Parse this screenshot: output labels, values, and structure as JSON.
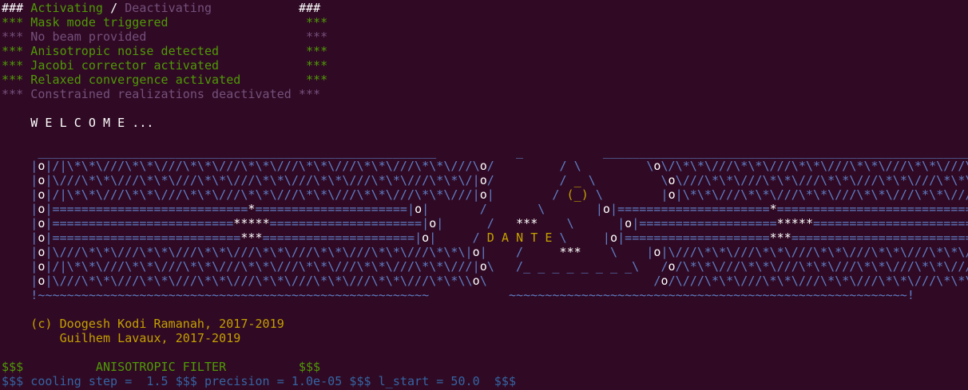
{
  "colors": {
    "background": "#300a24",
    "white": "#ffffff",
    "green": "#4e9a06",
    "purple": "#75507b",
    "blue": "#5f7fc7",
    "orange": "#c4a000",
    "dark_blue": "#3465a4"
  },
  "lines": [
    [
      {
        "t": "### ",
        "c": "w"
      },
      {
        "t": "Activating",
        "c": "g"
      },
      {
        "t": " / ",
        "c": "w"
      },
      {
        "t": "Deactivating",
        "c": "m"
      },
      {
        "t": "            ",
        "c": "w"
      },
      {
        "t": "###",
        "c": "w"
      }
    ],
    [
      {
        "t": "*** Mask mode triggered                   ***",
        "c": "g"
      }
    ],
    [
      {
        "t": "*** No beam provided                      ***",
        "c": "m"
      }
    ],
    [
      {
        "t": "*** Anisotropic noise detected            ***",
        "c": "g"
      }
    ],
    [
      {
        "t": "*** Jacobi corrector activated            ***",
        "c": "g"
      }
    ],
    [
      {
        "t": "*** Relaxed convergence activated         ***",
        "c": "g"
      }
    ],
    [
      {
        "t": "*** Constrained realizations deactivated ***",
        "c": "m"
      }
    ],
    [
      {
        "t": "",
        "c": "w"
      }
    ],
    [
      {
        "t": "    W E L C O M E ...",
        "c": "w"
      }
    ],
    [
      {
        "t": "",
        "c": "w"
      }
    ],
    [
      {
        "t": "     _______________________________________________________           _           _______________________________________________________",
        "c": "b"
      }
    ],
    [
      {
        "t": "    |",
        "c": "b"
      },
      {
        "t": "o",
        "c": "w"
      },
      {
        "t": "|/|\\*\\*\\///\\*\\*\\///\\*\\*\\///\\*\\*\\///\\*\\*\\///\\*\\*\\///\\*\\*\\///\\",
        "c": "b"
      },
      {
        "t": "o",
        "c": "w"
      },
      {
        "t": "/         / \\         \\",
        "c": "b"
      },
      {
        "t": "o",
        "c": "w"
      },
      {
        "t": "\\/\\*\\*\\///\\*\\*\\///\\*\\*\\///\\*\\*\\///\\*\\*\\///\\*\\*\\///\\*\\*\\///|",
        "c": "b"
      },
      {
        "t": "o",
        "c": "w"
      },
      {
        "t": "|",
        "c": "b"
      }
    ],
    [
      {
        "t": "    |",
        "c": "b"
      },
      {
        "t": "o",
        "c": "w"
      },
      {
        "t": "|\\///\\*\\*\\///\\*\\*\\///\\*\\*\\///\\*\\*\\///\\*\\*\\///\\*\\*\\///\\*\\*\\/|",
        "c": "b"
      },
      {
        "t": "o",
        "c": "w"
      },
      {
        "t": "/         /",
        "c": "b"
      },
      {
        "t": " _ ",
        "c": "o"
      },
      {
        "t": "\\         \\",
        "c": "b"
      },
      {
        "t": "o",
        "c": "w"
      },
      {
        "t": "\\///\\*\\*\\///\\*\\*\\///\\*\\*\\///\\*\\*\\///\\*\\*\\///\\*\\*\\///\\*\\*\\/|",
        "c": "b"
      },
      {
        "t": "o",
        "c": "w"
      },
      {
        "t": "|",
        "c": "b"
      }
    ],
    [
      {
        "t": "    |",
        "c": "b"
      },
      {
        "t": "o",
        "c": "w"
      },
      {
        "t": "|/|\\*\\*\\///\\*\\*\\///\\*\\*\\///\\*\\*\\///\\*\\*\\///\\*\\*\\///\\*\\*\\///|",
        "c": "b"
      },
      {
        "t": "o",
        "c": "w"
      },
      {
        "t": "|        /",
        "c": "b"
      },
      {
        "t": " (_) ",
        "c": "o"
      },
      {
        "t": "\\        |",
        "c": "b"
      },
      {
        "t": "o",
        "c": "w"
      },
      {
        "t": "|\\*\\*\\///\\*\\*\\///\\*\\*\\///\\*\\*\\///\\*\\*\\///\\*\\*\\///\\*\\*\\///|",
        "c": "b"
      },
      {
        "t": "o",
        "c": "w"
      },
      {
        "t": "|",
        "c": "b"
      }
    ],
    [
      {
        "t": "    |",
        "c": "b"
      },
      {
        "t": "o",
        "c": "w"
      },
      {
        "t": "|===========================",
        "c": "b"
      },
      {
        "t": "*",
        "c": "w"
      },
      {
        "t": "=====================|",
        "c": "b"
      },
      {
        "t": "o",
        "c": "w"
      },
      {
        "t": "|       /       \\       |",
        "c": "b"
      },
      {
        "t": "o",
        "c": "w"
      },
      {
        "t": "|=====================",
        "c": "b"
      },
      {
        "t": "*",
        "c": "w"
      },
      {
        "t": "===========================|",
        "c": "b"
      },
      {
        "t": "o",
        "c": "w"
      },
      {
        "t": "|",
        "c": "b"
      }
    ],
    [
      {
        "t": "    |",
        "c": "b"
      },
      {
        "t": "o",
        "c": "w"
      },
      {
        "t": "|=========================",
        "c": "b"
      },
      {
        "t": "*****",
        "c": "w"
      },
      {
        "t": "=====================|",
        "c": "b"
      },
      {
        "t": "o",
        "c": "w"
      },
      {
        "t": "|      /  ",
        "c": "b"
      },
      {
        "t": " ***  ",
        "c": "w"
      },
      {
        "t": "  \\      |",
        "c": "b"
      },
      {
        "t": "o",
        "c": "w"
      },
      {
        "t": "|===================",
        "c": "b"
      },
      {
        "t": "*****",
        "c": "w"
      },
      {
        "t": "===========================|",
        "c": "b"
      },
      {
        "t": "o",
        "c": "w"
      },
      {
        "t": "|",
        "c": "b"
      }
    ],
    [
      {
        "t": "    |",
        "c": "b"
      },
      {
        "t": "o",
        "c": "w"
      },
      {
        "t": "|==========================",
        "c": "b"
      },
      {
        "t": "***",
        "c": "w"
      },
      {
        "t": "=====================|",
        "c": "b"
      },
      {
        "t": "o",
        "c": "w"
      },
      {
        "t": "|     / ",
        "c": "b"
      },
      {
        "t": "D A N T E",
        "c": "o"
      },
      {
        "t": " \\     |",
        "c": "b"
      },
      {
        "t": "o",
        "c": "w"
      },
      {
        "t": "|====================",
        "c": "b"
      },
      {
        "t": "***",
        "c": "w"
      },
      {
        "t": "============================|",
        "c": "b"
      },
      {
        "t": "o",
        "c": "w"
      },
      {
        "t": "|",
        "c": "b"
      }
    ],
    [
      {
        "t": "    |",
        "c": "b"
      },
      {
        "t": "o",
        "c": "w"
      },
      {
        "t": "|\\///\\*\\*\\///\\*\\*\\///\\*\\*\\///\\*\\*\\///\\*\\*\\///\\*\\*\\///\\*\\*\\|",
        "c": "b"
      },
      {
        "t": "o",
        "c": "w"
      },
      {
        "t": "|    /    ",
        "c": "b"
      },
      {
        "t": " *** ",
        "c": "w"
      },
      {
        "t": "   \\    |",
        "c": "b"
      },
      {
        "t": "o",
        "c": "w"
      },
      {
        "t": "|\\///\\*\\*\\///\\*\\*\\///\\*\\*\\///\\*\\*\\///\\*\\*\\///\\*\\*\\///\\*\\*\\/|",
        "c": "b"
      },
      {
        "t": "o",
        "c": "w"
      },
      {
        "t": "|",
        "c": "b"
      }
    ],
    [
      {
        "t": "    |",
        "c": "b"
      },
      {
        "t": "o",
        "c": "w"
      },
      {
        "t": "|/|\\*\\*\\///\\*\\*\\///\\*\\*\\///\\*\\*\\///\\*\\*\\///\\*\\*\\///\\*\\*\\///|",
        "c": "b"
      },
      {
        "t": "o",
        "c": "w"
      },
      {
        "t": "\\   /_ _ _ _ _ _ _ _\\   /",
        "c": "b"
      },
      {
        "t": "o",
        "c": "w"
      },
      {
        "t": "/\\*\\*\\///\\*\\*\\///\\*\\*\\///\\*\\*\\///\\*\\*\\///\\*\\*\\///\\*\\*\\///|",
        "c": "b"
      },
      {
        "t": "o",
        "c": "w"
      },
      {
        "t": "|",
        "c": "b"
      }
    ],
    [
      {
        "t": "    |",
        "c": "b"
      },
      {
        "t": "o",
        "c": "w"
      },
      {
        "t": "|\\///\\*\\*\\///\\*\\*\\///\\*\\*\\///\\*\\*\\///\\*\\*\\///\\*\\*\\///\\*\\*\\\\",
        "c": "b"
      },
      {
        "t": "o",
        "c": "w"
      },
      {
        "t": "\\                       /",
        "c": "b"
      },
      {
        "t": "o",
        "c": "w"
      },
      {
        "t": "/\\///\\*\\*\\///\\*\\*\\///\\*\\*\\///\\*\\*\\///\\*\\*\\///\\*\\*\\///\\*\\*\\/|",
        "c": "b"
      },
      {
        "t": "o",
        "c": "w"
      },
      {
        "t": "|",
        "c": "b"
      }
    ],
    [
      {
        "t": "    !~~~~~~~~~~~~~~~~~~~~~~~~~~~~~~~~~~~~~~~~~~~~~~~~~~~~~~           ~~~~~~~~~~~~~~~~~~~~~~~~~~~~~~~~~~~~~~~~~~~~~~~~~~~~~~~!",
        "c": "b"
      }
    ],
    [
      {
        "t": "",
        "c": "w"
      }
    ],
    [
      {
        "t": "    (c) Doogesh Kodi Ramanah, 2017-2019",
        "c": "o"
      }
    ],
    [
      {
        "t": "        Guilhem Lavaux, 2017-2019",
        "c": "o"
      }
    ],
    [
      {
        "t": "",
        "c": "w"
      }
    ],
    [
      {
        "t": "$$$          ANISOTROPIC FILTER          $$$",
        "c": "g"
      }
    ],
    [
      {
        "t": "$$$ cooling step =  1.5 $$$ precision = 1.0e-05 $$$ l_start = 50.0  $$$",
        "c": "bb"
      }
    ]
  ]
}
